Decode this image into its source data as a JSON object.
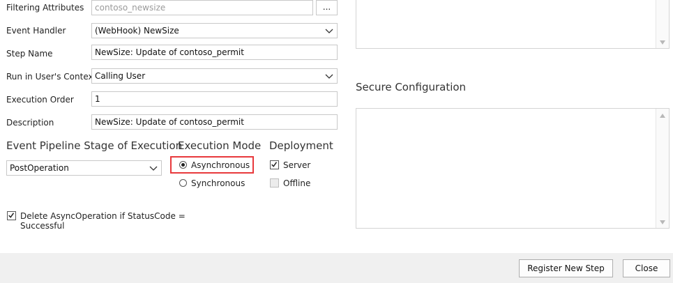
{
  "form": {
    "filtering_attributes": {
      "label": "Filtering Attributes",
      "value": "contoso_newsize",
      "button": "..."
    },
    "event_handler": {
      "label": "Event Handler",
      "value": "(WebHook) NewSize"
    },
    "step_name": {
      "label": "Step Name",
      "value": "NewSize: Update of contoso_permit"
    },
    "run_context": {
      "label": "Run in User's Context",
      "value": "Calling User"
    },
    "execution_order": {
      "label": "Execution Order",
      "value": "1"
    },
    "description": {
      "label": "Description",
      "value": "NewSize: Update of contoso_permit"
    }
  },
  "pipeline": {
    "heading": "Event Pipeline Stage of Execution",
    "value": "PostOperation"
  },
  "execution_mode": {
    "heading": "Execution Mode",
    "options": [
      {
        "label": "Asynchronous",
        "selected": true
      },
      {
        "label": "Synchronous",
        "selected": false
      }
    ]
  },
  "deployment": {
    "heading": "Deployment",
    "options": [
      {
        "label": "Server",
        "checked": true,
        "enabled": true
      },
      {
        "label": "Offline",
        "checked": false,
        "enabled": false
      }
    ]
  },
  "delete_async": {
    "label": "Delete AsyncOperation if StatusCode = Successful",
    "checked": true
  },
  "secure_config": {
    "heading": "Secure  Configuration"
  },
  "footer": {
    "register_button": "Register New Step",
    "close_button": "Close"
  },
  "colors": {
    "highlight": "#e8393c",
    "footer_bg": "#f0f0f0"
  }
}
